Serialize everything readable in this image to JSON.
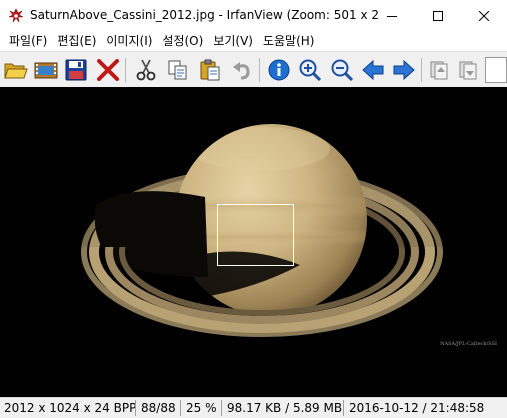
{
  "window": {
    "title": "SaturnAbove_Cassini_2012.jpg - IrfanView (Zoom: 501 x 25...",
    "app_icon": "irfanview-icon"
  },
  "menu": [
    {
      "label": "파일(F)"
    },
    {
      "label": "편집(E)"
    },
    {
      "label": "이미지(I)"
    },
    {
      "label": "설정(O)"
    },
    {
      "label": "보기(V)"
    },
    {
      "label": "도움말(H)"
    }
  ],
  "toolbar": {
    "buttons": [
      "open-icon",
      "slideshow-icon",
      "save-icon",
      "delete-icon",
      "cut-icon",
      "copy-icon",
      "paste-icon",
      "undo-icon",
      "info-icon",
      "zoom-in-icon",
      "zoom-out-icon",
      "previous-icon",
      "next-icon",
      "page-up-icon",
      "page-down-icon"
    ]
  },
  "image": {
    "credit": "NASA/JPL-Caltech/SSI"
  },
  "status": {
    "dimensions": "2012 x 1024 x 24 BPP",
    "index": "88/88",
    "zoom": "25 %",
    "size": "98.17 KB / 5.89 MB",
    "datetime": "2016-10-12 / 21:48:58"
  },
  "colors": {
    "background": "#000000",
    "accent": "#1e6fd0"
  }
}
